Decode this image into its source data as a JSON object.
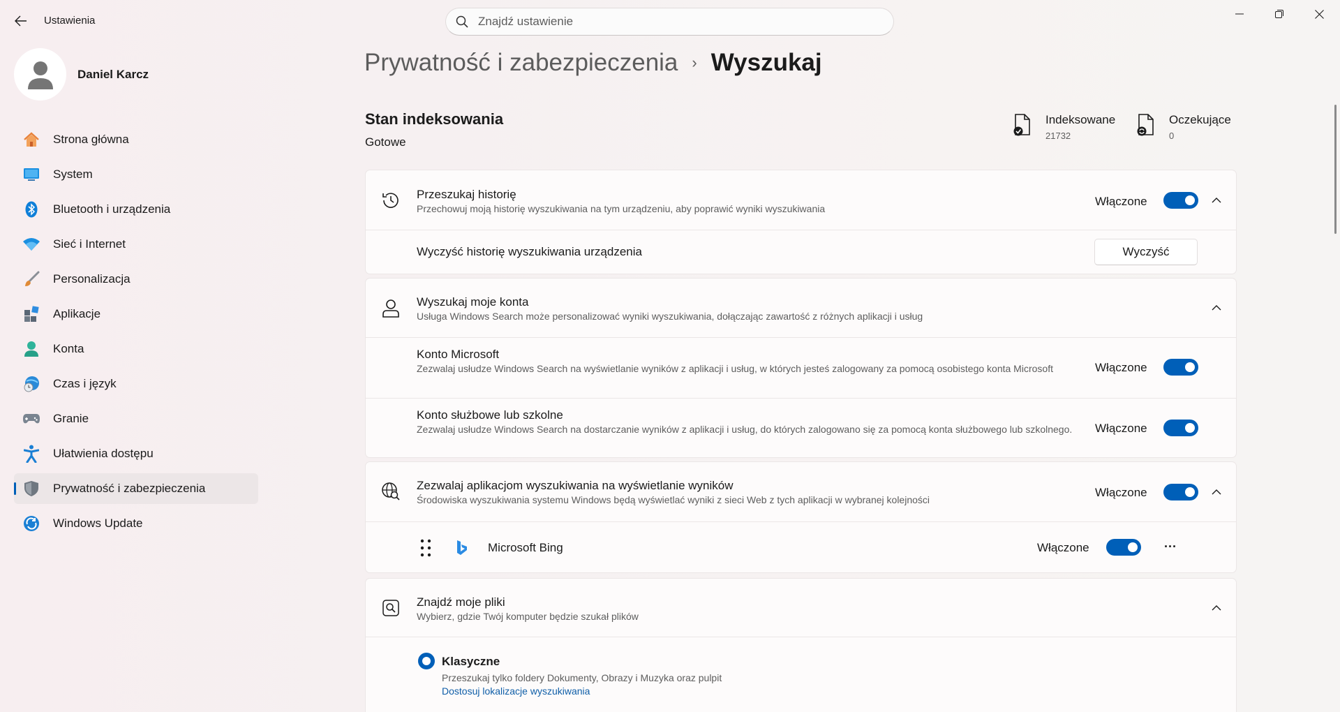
{
  "app": {
    "title": "Ustawienia"
  },
  "search": {
    "placeholder": "Znajdź ustawienie"
  },
  "profile": {
    "name": "Daniel Karcz"
  },
  "nav": [
    {
      "label": "Strona główna",
      "icon": "home-icon",
      "color": "#e8823a"
    },
    {
      "label": "System",
      "icon": "monitor-icon",
      "color": "#0f7fd8"
    },
    {
      "label": "Bluetooth i urządzenia",
      "icon": "bluetooth-icon",
      "color": "#0f7fd8"
    },
    {
      "label": "Sieć i Internet",
      "icon": "wifi-icon",
      "color": "#1a8fe0"
    },
    {
      "label": "Personalizacja",
      "icon": "brush-icon",
      "color": "#d88a3a"
    },
    {
      "label": "Aplikacje",
      "icon": "apps-icon",
      "color": "#5a6675"
    },
    {
      "label": "Konta",
      "icon": "person-icon",
      "color": "#2fb39a"
    },
    {
      "label": "Czas i język",
      "icon": "clock-globe-icon",
      "color": "#2a8ad8"
    },
    {
      "label": "Granie",
      "icon": "gamepad-icon",
      "color": "#7a8490"
    },
    {
      "label": "Ułatwienia dostępu",
      "icon": "accessibility-icon",
      "color": "#1a7fd4"
    },
    {
      "label": "Prywatność i zabezpieczenia",
      "icon": "shield-icon",
      "color": "#6f7780",
      "active": true
    },
    {
      "label": "Windows Update",
      "icon": "update-icon",
      "color": "#1a7fd4"
    }
  ],
  "breadcrumb": {
    "parent": "Prywatność i zabezpieczenia",
    "separator": "›",
    "current": "Wyszukaj"
  },
  "indexing": {
    "title": "Stan indeksowania",
    "status": "Gotowe",
    "indexed_label": "Indeksowane",
    "indexed_value": "21732",
    "pending_label": "Oczekujące",
    "pending_value": "0"
  },
  "history": {
    "title": "Przeszukaj historię",
    "desc": "Przechowuj moją historię wyszukiwania na tym urządzeniu, aby poprawić wyniki wyszukiwania",
    "state": "Włączone",
    "clear_label": "Wyczyść historię wyszukiwania urządzenia",
    "clear_button": "Wyczyść"
  },
  "accounts": {
    "title": "Wyszukaj moje konta",
    "desc": "Usługa Windows Search może personalizować wyniki wyszukiwania, dołączając zawartość z różnych aplikacji i usług",
    "microsoft_title": "Konto Microsoft",
    "microsoft_desc": "Zezwalaj usłudze Windows Search na wyświetlanie wyników z aplikacji i usług, w których jesteś zalogowany za pomocą osobistego konta Microsoft",
    "microsoft_state": "Włączone",
    "work_title": "Konto służbowe lub szkolne",
    "work_desc": "Zezwalaj usłudze Windows Search na dostarczanie wyników z aplikacji i usług, do których zalogowano się za pomocą konta służbowego lub szkolnego.",
    "work_state": "Włączone"
  },
  "apps": {
    "title": "Zezwalaj aplikacjom wyszukiwania na wyświetlanie wyników",
    "desc": "Środowiska wyszukiwania systemu Windows będą wyświetlać wyniki z sieci Web z tych aplikacji w wybranej kolejności",
    "state": "Włączone",
    "bing_name": "Microsoft Bing",
    "bing_state": "Włączone",
    "more": "···"
  },
  "files": {
    "title": "Znajdź moje pliki",
    "desc": "Wybierz, gdzie Twój komputer będzie szukał plików",
    "classic_title": "Klasyczne",
    "classic_desc": "Przeszukaj tylko foldery Dokumenty, Obrazy i Muzyka oraz pulpit",
    "classic_link": "Dostosuj lokalizacje wyszukiwania"
  },
  "colors": {
    "accent": "#005fb8",
    "link": "#0f5ea8"
  }
}
